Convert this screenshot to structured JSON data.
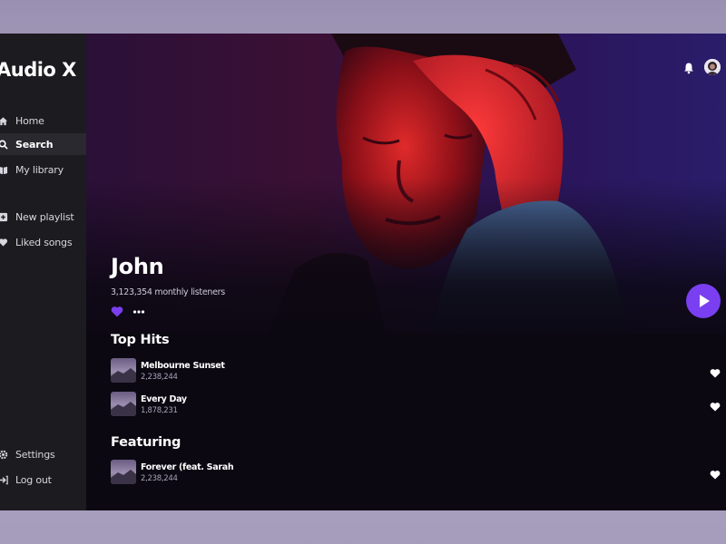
{
  "app": {
    "logo": "Audio X"
  },
  "sidebar": {
    "items": [
      {
        "label": "Home",
        "icon": "home-icon",
        "active": false
      },
      {
        "label": "Search",
        "icon": "search-icon",
        "active": true
      },
      {
        "label": "My library",
        "icon": "library-icon",
        "active": false
      },
      {
        "label": "New playlist",
        "icon": "plus-square-icon",
        "active": false
      },
      {
        "label": "Liked songs",
        "icon": "heart-icon",
        "active": false
      },
      {
        "label": "Settings",
        "icon": "gear-icon",
        "active": false
      },
      {
        "label": "Log out",
        "icon": "logout-icon",
        "active": false
      }
    ]
  },
  "header": {
    "icons": [
      "bell-icon",
      "avatar"
    ]
  },
  "artist": {
    "name": "John",
    "listeners": "3,123,354 monthly listeners"
  },
  "sections": {
    "top_hits": {
      "title": "Top Hits",
      "tracks": [
        {
          "title": "Melbourne Sunset",
          "plays": "2,238,244"
        },
        {
          "title": "Every Day",
          "plays": "1,878,231"
        }
      ]
    },
    "featuring": {
      "title": "Featuring",
      "tracks": [
        {
          "title": "Forever (feat. Sarah",
          "plays": "2,238,244"
        }
      ]
    }
  },
  "colors": {
    "accent": "#7a3ff0",
    "sidebar_bg": "#1c1b20",
    "main_bg": "#0b0812"
  }
}
